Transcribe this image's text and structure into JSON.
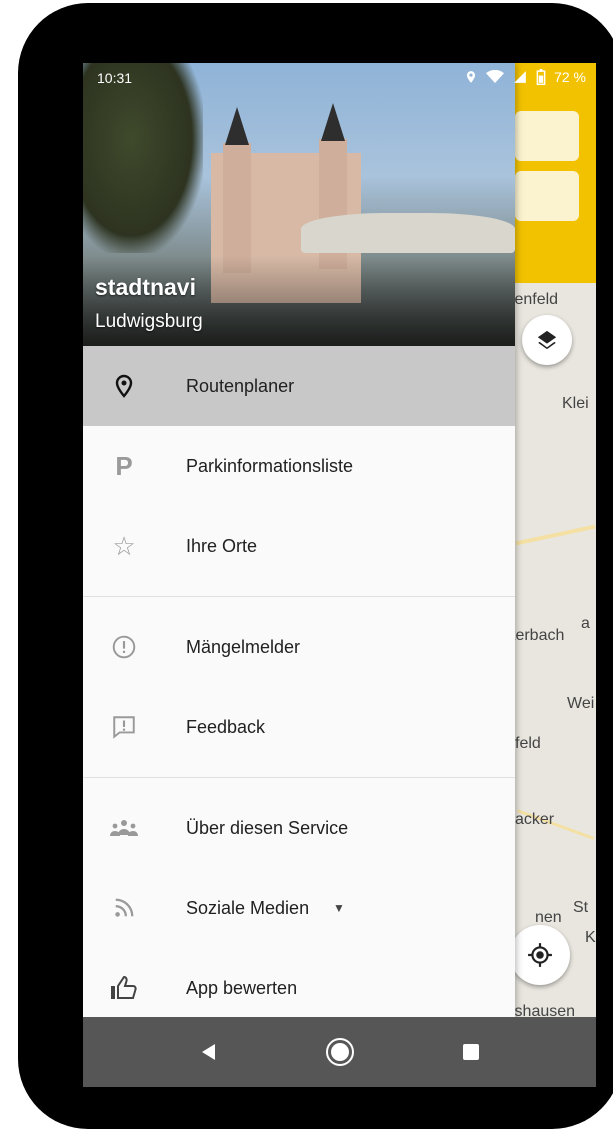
{
  "status_bar": {
    "time": "10:31",
    "battery": "72 %"
  },
  "map": {
    "labels": [
      "tenfeld",
      "Klei",
      "terbach",
      "a",
      "Wei",
      "feld",
      "acker",
      "St",
      "K",
      "lshausen",
      "nen"
    ]
  },
  "drawer": {
    "brand": "stadtnavi",
    "city": "Ludwigsburg",
    "items": [
      {
        "label": "Routenplaner",
        "icon": "map-pin-icon"
      },
      {
        "label": "Parkinformationsliste",
        "icon": "parking-icon"
      },
      {
        "label": "Ihre Orte",
        "icon": "star-outline-icon"
      },
      {
        "label": "Mängelmelder",
        "icon": "alert-circle-icon"
      },
      {
        "label": "Feedback",
        "icon": "feedback-icon"
      },
      {
        "label": "Über diesen Service",
        "icon": "people-icon"
      },
      {
        "label": "Soziale Medien",
        "icon": "rss-icon"
      },
      {
        "label": "App bewerten",
        "icon": "thumbs-up-icon"
      }
    ]
  },
  "colors": {
    "accent": "#f2c200",
    "active_item": "#c8c8c8",
    "navbar": "#565656"
  }
}
